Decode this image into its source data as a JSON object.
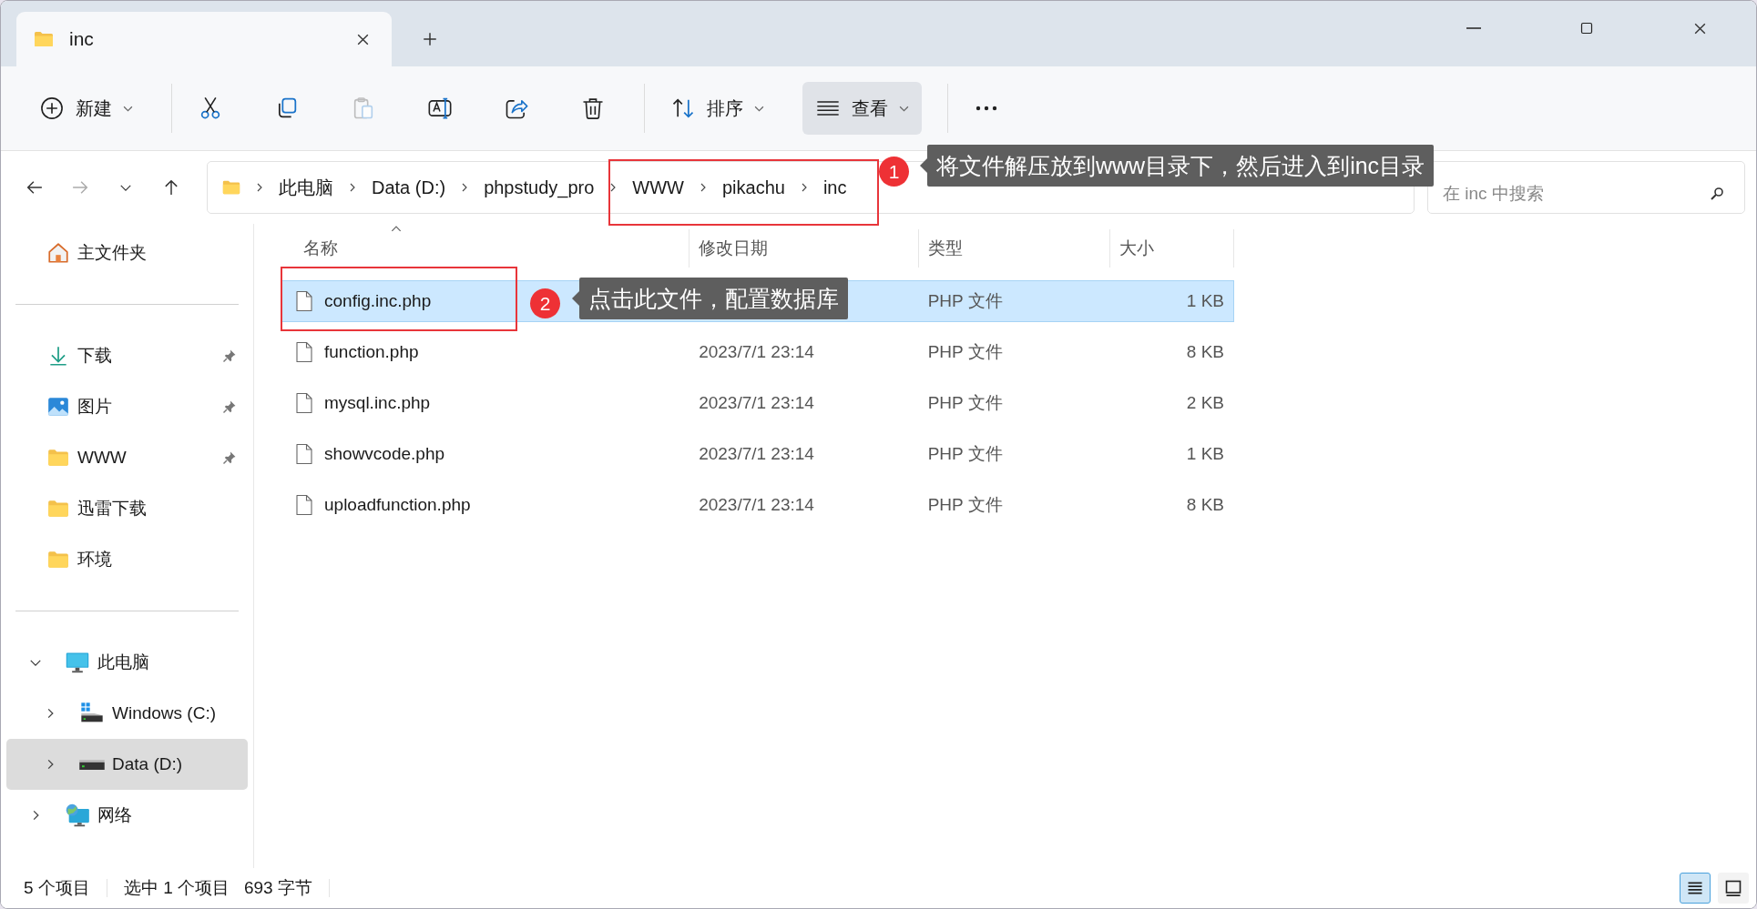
{
  "window": {
    "tab_title": "inc"
  },
  "toolbar": [
    {
      "kind": "new",
      "label": "新建",
      "disabled": false,
      "selected": false
    },
    {
      "kind": "cut",
      "disabled": false,
      "selected": false
    },
    {
      "kind": "copy",
      "disabled": false,
      "selected": false
    },
    {
      "kind": "paste",
      "disabled": true,
      "selected": false
    },
    {
      "kind": "rename",
      "disabled": false,
      "selected": false
    },
    {
      "kind": "share",
      "disabled": false,
      "selected": false
    },
    {
      "kind": "delete",
      "disabled": false,
      "selected": false
    },
    {
      "kind": "sort",
      "label": "排序",
      "disabled": false,
      "selected": false
    },
    {
      "kind": "view",
      "label": "查看",
      "disabled": false,
      "selected": true
    },
    {
      "kind": "more",
      "disabled": false,
      "selected": false
    }
  ],
  "breadcrumb": [
    "此电脑",
    "Data (D:)",
    "phpstudy_pro",
    "WWW",
    "pikachu",
    "inc"
  ],
  "search": {
    "placeholder": "在 inc 中搜索"
  },
  "sidebar": {
    "quick": [
      {
        "kind": "home",
        "label": "主文件夹",
        "pinned": false,
        "selected": false
      }
    ],
    "pinned": [
      {
        "kind": "download",
        "label": "下载",
        "pinned": true,
        "selected": false
      },
      {
        "kind": "pictures",
        "label": "图片",
        "pinned": true,
        "selected": false
      },
      {
        "kind": "folder",
        "label": "WWW",
        "pinned": true,
        "selected": false
      },
      {
        "kind": "folder",
        "label": "迅雷下载",
        "pinned": false,
        "selected": false
      },
      {
        "kind": "folder",
        "label": "环境",
        "pinned": false,
        "selected": false
      }
    ],
    "tree": [
      {
        "kind": "pc",
        "label": "此电脑",
        "expanded": true,
        "selected": false,
        "children": [
          {
            "kind": "drive-windows",
            "label": "Windows (C:)",
            "expanded": false,
            "selected": false
          },
          {
            "kind": "drive",
            "label": "Data (D:)",
            "expanded": false,
            "selected": true
          }
        ]
      },
      {
        "kind": "network",
        "label": "网络",
        "expanded": false,
        "selected": false
      }
    ]
  },
  "columns": [
    "名称",
    "修改日期",
    "类型",
    "大小"
  ],
  "rows": [
    {
      "name": "config.inc.php",
      "type": "PHP 文件",
      "size": "1 KB",
      "selected": true
    },
    {
      "name": "function.php",
      "modified": "2023/7/1 23:14",
      "type": "PHP 文件",
      "size": "8 KB",
      "selected": false
    },
    {
      "name": "mysql.inc.php",
      "modified": "2023/7/1 23:14",
      "type": "PHP 文件",
      "size": "2 KB",
      "selected": false
    },
    {
      "name": "showvcode.php",
      "modified": "2023/7/1 23:14",
      "type": "PHP 文件",
      "size": "1 KB",
      "selected": false
    },
    {
      "name": "uploadfunction.php",
      "modified": "2023/7/1 23:14",
      "type": "PHP 文件",
      "size": "8 KB",
      "selected": false
    }
  ],
  "status_bar": {
    "item_count": "5 个项目",
    "selection": "选中 1 个项目",
    "selection_size": "693 字节"
  },
  "view_modes": [
    {
      "kind": "details",
      "selected": true
    },
    {
      "kind": "tiles",
      "selected": false
    }
  ],
  "annotations": [
    {
      "number": "1",
      "text": "将文件解压放到www目录下，然后进入到inc目录"
    },
    {
      "number": "2",
      "text": "点击此文件，配置数据库"
    }
  ]
}
